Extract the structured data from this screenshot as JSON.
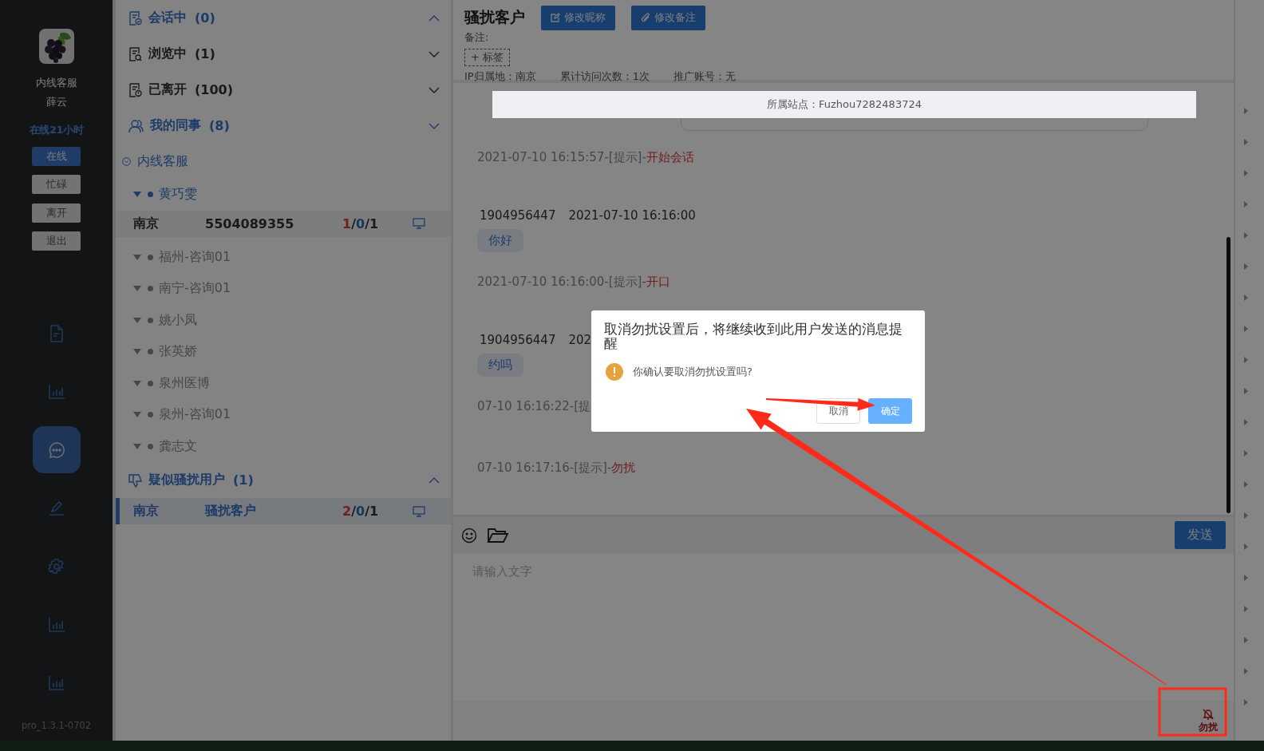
{
  "sidebar": {
    "user_group": "内线客服",
    "user_name": "薛云",
    "online_time": "在线21小时",
    "status_buttons": [
      {
        "label": "在线",
        "selected": true
      },
      {
        "label": "忙碌",
        "selected": false
      },
      {
        "label": "离开",
        "selected": false
      },
      {
        "label": "退出",
        "selected": false
      }
    ],
    "nav": [
      {
        "kind": "document",
        "selected": false
      },
      {
        "kind": "chart",
        "selected": false
      },
      {
        "kind": "chat",
        "selected": true
      },
      {
        "kind": "edit",
        "selected": false
      },
      {
        "kind": "settings",
        "selected": false
      },
      {
        "kind": "chart",
        "selected": false
      },
      {
        "kind": "chart",
        "selected": false
      }
    ],
    "version": "pro_1.3.1-0702"
  },
  "contacts": {
    "sections": [
      {
        "kind": "chat",
        "title": "会话中",
        "count": "(0)",
        "highlighted": true,
        "expanded": true
      },
      {
        "kind": "browsing",
        "title": "浏览中",
        "count": "(1)",
        "highlighted": false,
        "expanded": false
      },
      {
        "kind": "left",
        "title": "已离开",
        "count": "(100)",
        "highlighted": false,
        "expanded": false
      },
      {
        "kind": "colleagues",
        "title": "我的同事",
        "count": "(8)",
        "highlighted": true,
        "expanded": false,
        "children": [
          {
            "label": "内线客服",
            "children": [
              {
                "label": "黄巧雯",
                "online": true,
                "visitors": [
                  {
                    "city": "南京",
                    "name": "5504089355",
                    "selected": false,
                    "counts": [
                      {
                        "text": "1",
                        "kind": "unread"
                      },
                      {
                        "text": "/",
                        "kind": "separator"
                      },
                      {
                        "text": "0",
                        "kind": "waiting"
                      },
                      {
                        "text": "/",
                        "kind": "separator"
                      },
                      {
                        "text": "1",
                        "kind": "total"
                      }
                    ]
                  }
                ]
              },
              {
                "label": "福州-咨询01",
                "online": false
              },
              {
                "label": "南宁-咨询01",
                "online": false
              },
              {
                "label": "姚小凤",
                "online": false
              },
              {
                "label": "张英娇",
                "online": false
              },
              {
                "label": "泉州医博",
                "online": false
              },
              {
                "label": "泉州-咨询01",
                "online": false
              },
              {
                "label": "龚志文",
                "online": false
              }
            ]
          }
        ]
      },
      {
        "kind": "harass",
        "title": "疑似骚扰用户",
        "count": "(1)",
        "highlighted": true,
        "expanded": true,
        "visitors": [
          {
            "city": "南京",
            "name": "骚扰客户",
            "selected": true,
            "counts": [
              {
                "text": "2",
                "kind": "unread"
              },
              {
                "text": "/",
                "kind": "separator"
              },
              {
                "text": "0",
                "kind": "waiting"
              },
              {
                "text": "/",
                "kind": "separator"
              },
              {
                "text": "1",
                "kind": "total"
              }
            ]
          }
        ]
      }
    ]
  },
  "chat": {
    "title": "骚扰客户",
    "buttons": [
      "修改昵称",
      "修改备注"
    ],
    "note_label": "备注:",
    "tag_button": "+ 标签",
    "info": [
      "IP归属地：南京",
      "累计访问次数：1次",
      "推广账号：无"
    ],
    "site_banner": "所属站点：Fuzhou7282483724",
    "messages": [
      {
        "kind": "system",
        "time": "2021-07-10 16:15:57-[提示]-",
        "event": "开始会话"
      },
      {
        "kind": "visitor",
        "sender": "1904956447",
        "time": "2021-07-10 16:16:00",
        "text": "你好"
      },
      {
        "kind": "system",
        "time": "2021-07-10 16:16:00-[提示]-",
        "event": "开口"
      },
      {
        "kind": "visitor",
        "sender": "1904956447",
        "time": "202",
        "text": "约吗"
      },
      {
        "kind": "system",
        "time": "07-10 16:16:22-[提"
      },
      {
        "kind": "system",
        "time": "07-10 16:17:16-[提示]-",
        "event": "勿扰"
      }
    ],
    "composer": {
      "placeholder": "请输入文字",
      "send": "发送",
      "dnd_label": "勿扰"
    }
  },
  "dialog": {
    "title": "取消勿扰设置后，将继续收到此用户发送的消息提醒",
    "message": "你确认要取消勿扰设置吗?",
    "buttons": [
      {
        "label": "取消",
        "kind": "secondary"
      },
      {
        "label": "确定",
        "kind": "primary"
      }
    ]
  }
}
